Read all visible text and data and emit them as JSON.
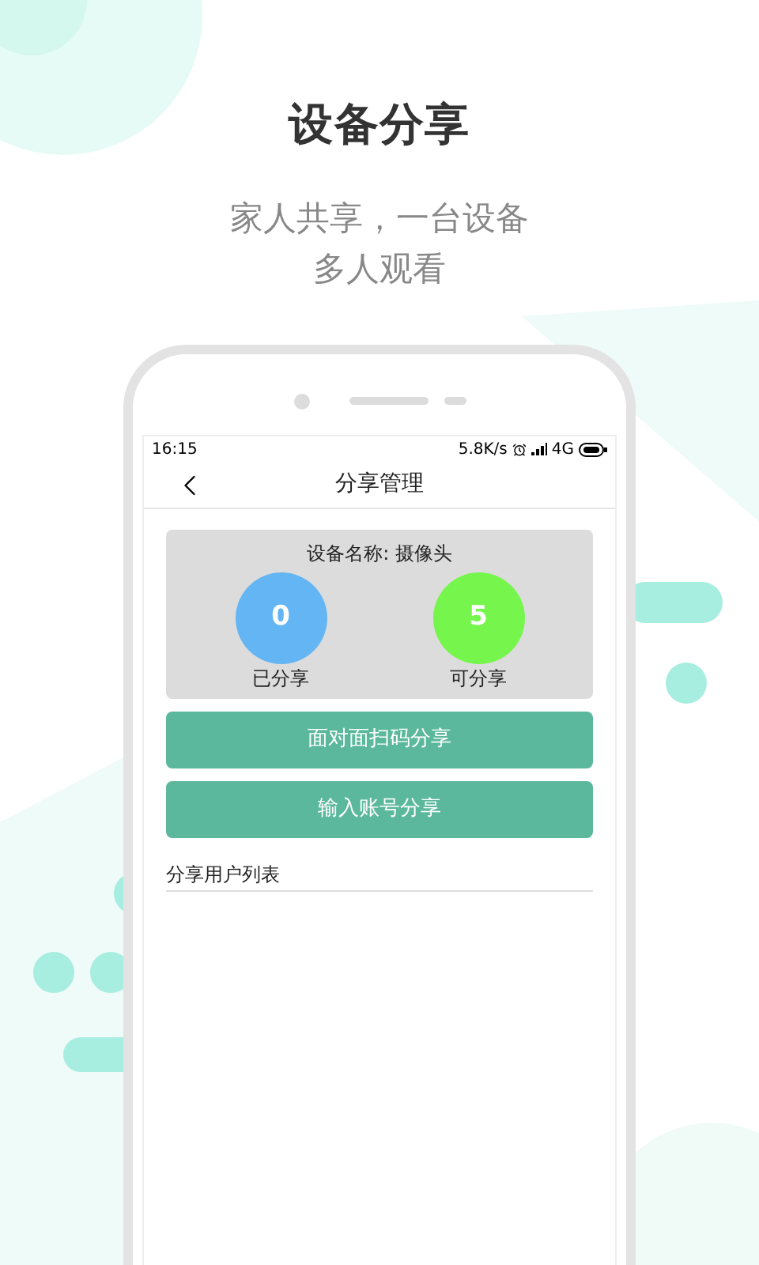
{
  "promo": {
    "title": "设备分享",
    "subtitle": [
      "家人共享，一台设备",
      "多人观看"
    ]
  },
  "status_bar": {
    "time": "16:15",
    "speed": "5.8K/s",
    "network": "4G"
  },
  "header": {
    "title": "分享管理"
  },
  "device": {
    "name": "设备名称: 摄像头",
    "stats": [
      {
        "value": "0",
        "label": "已分享",
        "color": "#64b5f3"
      },
      {
        "value": "5",
        "label": "可分享",
        "color": "#76f64c"
      }
    ]
  },
  "buttons": [
    "面对面扫码分享",
    "输入账号分享"
  ],
  "user_list": {
    "title": "分享用户列表"
  }
}
